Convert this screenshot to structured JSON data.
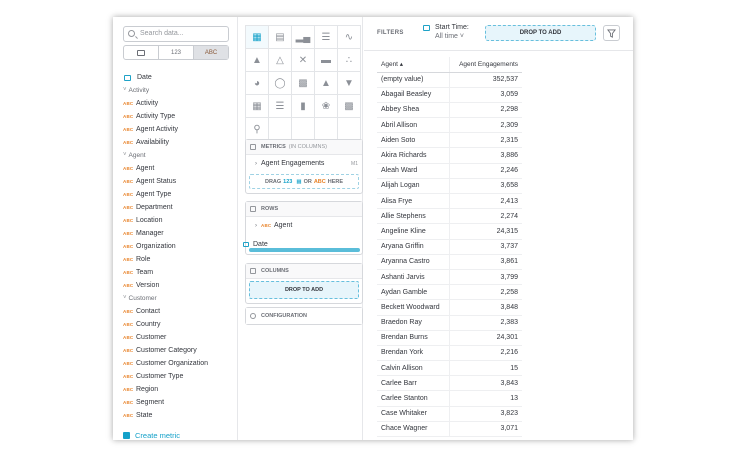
{
  "left": {
    "search_placeholder": "Search data...",
    "seg": {
      "num": "123",
      "abc": "ABC"
    },
    "date_label": "Date",
    "groups": [
      {
        "name": "Activity",
        "items": [
          "Activity",
          "Activity Type",
          "Agent Activity",
          "Availability"
        ]
      },
      {
        "name": "Agent",
        "items": [
          "Agent",
          "Agent Status",
          "Agent Type",
          "Department",
          "Location",
          "Manager",
          "Organization",
          "Role",
          "Team",
          "Version"
        ]
      },
      {
        "name": "Customer",
        "items": [
          "Contact",
          "Country",
          "Customer",
          "Customer Category",
          "Customer Organization",
          "Customer Type",
          "Region",
          "Segment",
          "State"
        ]
      }
    ],
    "abc_tag": "ABC",
    "create_metric": "Create metric"
  },
  "mid": {
    "metrics": {
      "title": "METRICS",
      "sub": "(IN COLUMNS)",
      "item": "Agent Engagements",
      "item_badge": "M1",
      "drag_text_1": "DRAG",
      "drag_tag_1": "123",
      "drag_text_2": "OR",
      "drag_tag_2": "ABC",
      "drag_text_3": "HERE"
    },
    "rows": {
      "title": "ROWS",
      "item_tag": "ABC",
      "item": "Agent"
    },
    "dragging": {
      "label": "Date"
    },
    "columns": {
      "title": "COLUMNS",
      "drop": "DROP TO ADD"
    },
    "configuration": {
      "title": "CONFIGURATION"
    }
  },
  "right": {
    "filters_label": "FILTERS",
    "start_time_label": "Start Time:",
    "start_time_value": "All time",
    "drop_to_add": "DROP TO ADD",
    "table": {
      "headers": [
        "Agent",
        "Agent Engagements"
      ],
      "rows": [
        [
          "(empty value)",
          "352,537"
        ],
        [
          "Abagail Beasley",
          "3,059"
        ],
        [
          "Abbey Shea",
          "2,298"
        ],
        [
          "Abril Allison",
          "2,309"
        ],
        [
          "Aiden Soto",
          "2,315"
        ],
        [
          "Akira Richards",
          "3,886"
        ],
        [
          "Aleah Ward",
          "2,246"
        ],
        [
          "Alijah Logan",
          "3,658"
        ],
        [
          "Alisa Frye",
          "2,413"
        ],
        [
          "Allie Stephens",
          "2,274"
        ],
        [
          "Angeline Kline",
          "24,315"
        ],
        [
          "Aryana Griffin",
          "3,737"
        ],
        [
          "Aryanna Castro",
          "3,861"
        ],
        [
          "Ashanti Jarvis",
          "3,799"
        ],
        [
          "Aydan Gamble",
          "2,258"
        ],
        [
          "Beckett Woodward",
          "3,848"
        ],
        [
          "Braedon Ray",
          "2,383"
        ],
        [
          "Brendan Burns",
          "24,301"
        ],
        [
          "Brendan York",
          "2,216"
        ],
        [
          "Calvin Allison",
          "15"
        ],
        [
          "Carlee Barr",
          "3,843"
        ],
        [
          "Carlee Stanton",
          "13"
        ],
        [
          "Case Whitaker",
          "3,823"
        ],
        [
          "Chace Wagner",
          "3,071"
        ]
      ]
    }
  }
}
